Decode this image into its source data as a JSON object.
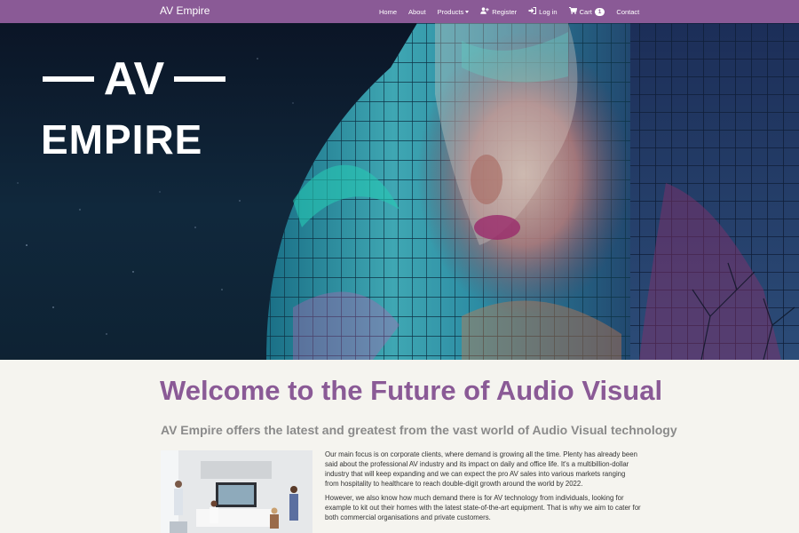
{
  "navbar": {
    "brand": "AV Empire",
    "items": [
      {
        "label": "Home",
        "icon": ""
      },
      {
        "label": "About",
        "icon": ""
      },
      {
        "label": "Products",
        "icon": "",
        "dropdown": true
      },
      {
        "label": "Register",
        "icon": "user-plus-icon"
      },
      {
        "label": "Log in",
        "icon": "sign-in-icon"
      },
      {
        "label": "Cart",
        "icon": "cart-icon",
        "badge": "1"
      },
      {
        "label": "Contact",
        "icon": ""
      }
    ],
    "background": "#8a5a96"
  },
  "hero": {
    "logo_line1": "AV",
    "logo_line2": "EMPIRE"
  },
  "main": {
    "heading": "Welcome to the Future of Audio Visual",
    "subheading": "AV Empire offers the latest and greatest from the vast world of Audio Visual technology",
    "paragraph1": "Our main focus is on corporate clients, where demand is growing all the time. Plenty has already been said about the professional AV industry and its impact on daily and office life. It's a multibillion-dollar industry that will keep expanding and we can expect the pro AV sales into various markets ranging from hospitality to healthcare to reach double-digit growth around the world by 2022.",
    "paragraph2": "However, we also know how much demand there is for AV technology from individuals, looking for example to kit out their homes with the latest state-of-the-art equipment. That is why we aim to cater for both commercial organisations and private customers.",
    "heading_color": "#8a5a96"
  }
}
